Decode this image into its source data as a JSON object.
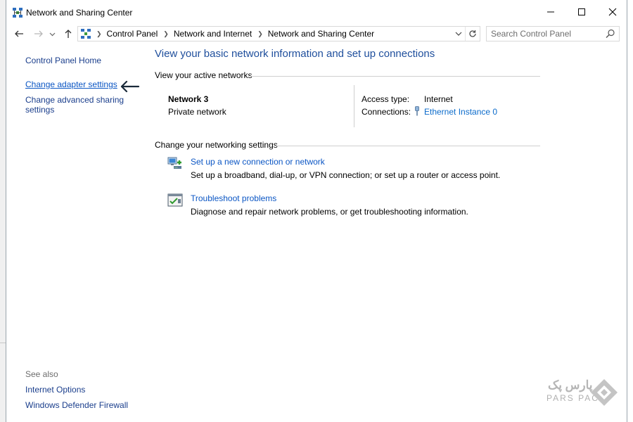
{
  "window": {
    "title": "Network and Sharing Center",
    "controls": {
      "minimize": "minimize-icon",
      "maximize": "maximize-icon",
      "close": "close-icon"
    }
  },
  "address_bar": {
    "breadcrumbs": [
      "Control Panel",
      "Network and Internet",
      "Network and Sharing Center"
    ],
    "search_placeholder": "Search Control Panel"
  },
  "left_nav": {
    "home": "Control Panel Home",
    "links": [
      "Change adapter settings",
      "Change advanced sharing settings"
    ],
    "see_also_heading": "See also",
    "see_also": [
      "Internet Options",
      "Windows Defender Firewall"
    ]
  },
  "main": {
    "title": "View your basic network information and set up connections",
    "active_networks": {
      "heading": "View your active networks",
      "network_name": "Network 3",
      "network_type": "Private network",
      "access_type_label": "Access type:",
      "access_type_value": "Internet",
      "connections_label": "Connections:",
      "connections_value": "Ethernet Instance 0"
    },
    "networking_settings": {
      "heading": "Change your networking settings",
      "tasks": [
        {
          "title": "Set up a new connection or network",
          "description": "Set up a broadband, dial-up, or VPN connection; or set up a router or access point.",
          "icon": "new-connection-icon"
        },
        {
          "title": "Troubleshoot problems",
          "description": "Diagnose and repair network problems, or get troubleshooting information.",
          "icon": "troubleshoot-icon"
        }
      ]
    }
  },
  "watermark": {
    "persian": "پارس پک",
    "latin": "PARS PACK"
  },
  "colors": {
    "link": "#0b56c4",
    "title": "#1e4e9c",
    "nav_link": "#1a3e8c",
    "annotation_arrow": "#1b2a3a"
  }
}
